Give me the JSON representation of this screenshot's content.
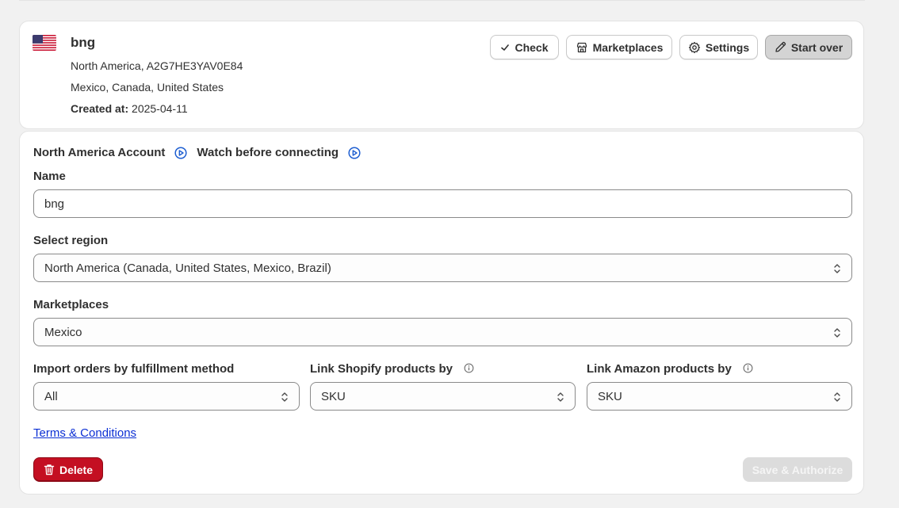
{
  "account": {
    "name": "bng",
    "region_line": "North America, A2G7HE3YAV0E84",
    "countries_line": "Mexico, Canada, United States",
    "created_label": "Created at:",
    "created_value": "2025-04-11"
  },
  "toolbar": {
    "check_label": "Check",
    "marketplaces_label": "Marketplaces",
    "settings_label": "Settings",
    "start_over_label": "Start over"
  },
  "form": {
    "section_title": "North America Account",
    "watch_label": "Watch before connecting",
    "name_label": "Name",
    "name_value": "bng",
    "region_label": "Select region",
    "region_value": "North America (Canada, United States, Mexico, Brazil)",
    "marketplaces_label": "Marketplaces",
    "marketplaces_value": "Mexico",
    "import_label": "Import orders by fulfillment method",
    "import_value": "All",
    "link_shopify_label": "Link Shopify products by",
    "link_shopify_value": "SKU",
    "link_amazon_label": "Link Amazon products by",
    "link_amazon_value": "SKU",
    "terms_link": "Terms & Conditions",
    "delete_label": "Delete",
    "save_label": "Save & Authorize"
  },
  "colors": {
    "delete_bg": "#c40f22",
    "link": "#0b2fd4",
    "play_icon": "#1f5fd1",
    "save_disabled_bg": "#dcdcdc"
  },
  "icons": [
    "us-flag-icon",
    "check-icon",
    "store-icon",
    "gear-icon",
    "pencil-icon",
    "play-circle-icon",
    "chevron-updown-icon",
    "info-icon",
    "trash-icon"
  ]
}
